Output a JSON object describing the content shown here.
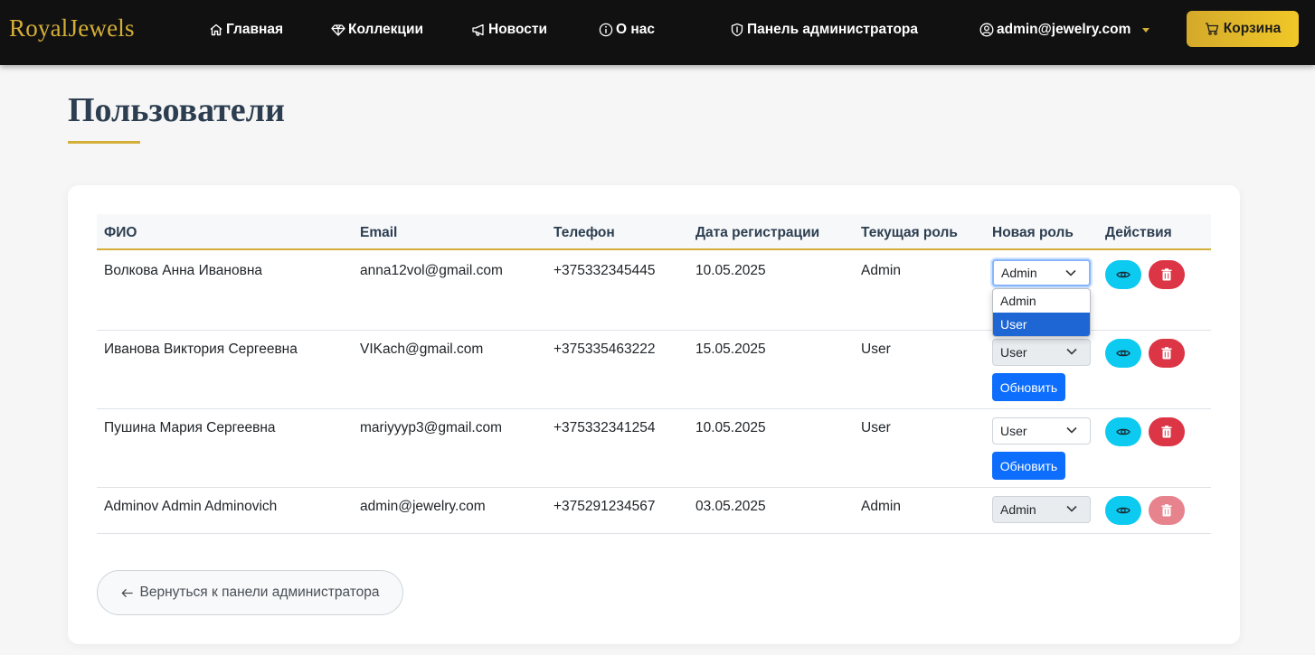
{
  "navbar": {
    "brand": "RoyalJewels",
    "items": [
      {
        "label": "Главная",
        "icon": "house-icon"
      },
      {
        "label": "Коллекции",
        "icon": "gem-icon"
      },
      {
        "label": "Новости",
        "icon": "megaphone-icon"
      },
      {
        "label": "О нас",
        "icon": "info-circle-icon"
      },
      {
        "label": "Панель администратора",
        "icon": "shield-icon"
      }
    ],
    "user": {
      "label": "admin@jewelry.com",
      "icon": "user-circle-icon"
    },
    "cart": {
      "label": "Корзина",
      "icon": "cart-icon"
    }
  },
  "page": {
    "title": "Пользователи",
    "accent_color": "#d4af37"
  },
  "table": {
    "headers": [
      "ФИО",
      "Email",
      "Телефон",
      "Дата регистрации",
      "Текущая роль",
      "Новая роль",
      "Действия"
    ],
    "rows": [
      {
        "name": "Волкова Анна Ивановна",
        "email": "anna12vol@gmail.com",
        "phone": "+375332345445",
        "date": "10.05.2025",
        "role": "Admin",
        "new_role": "Admin",
        "update": ""
      },
      {
        "name": "Иванова Виктория Сергеевна",
        "email": "VIKach@gmail.com",
        "phone": "+375335463222",
        "date": "15.05.2025",
        "role": "User",
        "new_role": "User",
        "update": "Обновить"
      },
      {
        "name": "Пушина Мария Сергеевна",
        "email": "mariyyyp3@gmail.com",
        "phone": "+375332341254",
        "date": "10.05.2025",
        "role": "User",
        "new_role": "User",
        "update": "Обновить"
      },
      {
        "name": "Adminov Admin Adminovich",
        "email": "admin@jewelry.com",
        "phone": "+375291234567",
        "date": "03.05.2025",
        "role": "Admin",
        "new_role": "Admin",
        "update": ""
      }
    ],
    "dropdown_options": [
      "Admin",
      "User"
    ],
    "dropdown_highlighted": "User"
  },
  "back_button": {
    "label": "Вернуться к панели администратора",
    "icon": "arrow-left-icon"
  }
}
